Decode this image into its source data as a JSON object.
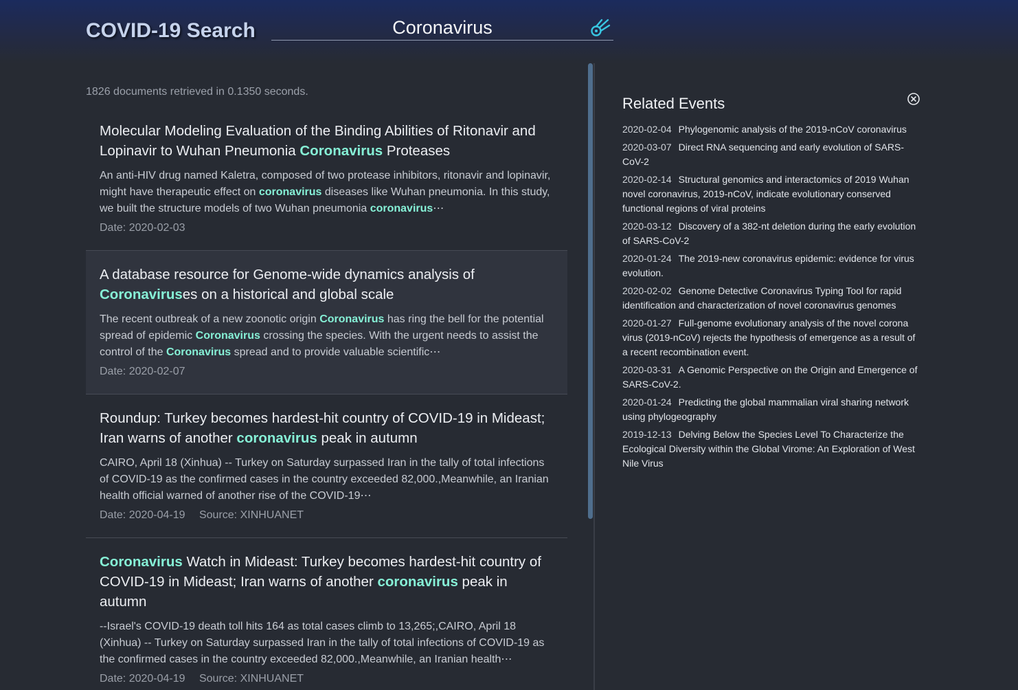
{
  "app": {
    "title": "COVID-19 Search"
  },
  "search": {
    "query": "Coronavirus",
    "submit_icon": "comet-icon"
  },
  "colors": {
    "accent": "#86f0d6",
    "icon": "#38c6e2",
    "header_top": "#1b2b5d",
    "background": "#272b33",
    "card_hover": "#30343e",
    "scrollbar": "#4f6e8d"
  },
  "results": {
    "stats": "1826 documents retrieved in 0.1350 seconds.",
    "items": [
      {
        "title": [
          {
            "text": "Molecular Modeling Evaluation of the Binding Abilities of Ritonavir and Lopinavir to Wuhan Pneumonia ",
            "hl": false
          },
          {
            "text": "Coronavirus",
            "hl": true
          },
          {
            "text": " Proteases",
            "hl": false
          }
        ],
        "snippet": [
          {
            "text": "An anti-HIV drug named Kaletra, composed of two protease inhibitors, ritonavir and lopinavir, might have therapeutic effect on ",
            "hl": false
          },
          {
            "text": "coronavirus",
            "hl": true
          },
          {
            "text": " diseases like Wuhan pneumonia. In this study, we built the structure models of two Wuhan pneumonia ",
            "hl": false
          },
          {
            "text": "coronavirus",
            "hl": true
          },
          {
            "text": "⋯",
            "hl": false
          }
        ],
        "date": "Date: 2020-02-03"
      },
      {
        "title": [
          {
            "text": "A database resource for Genome-wide dynamics analysis of ",
            "hl": false
          },
          {
            "text": "Coronavirus",
            "hl": true
          },
          {
            "text": "es on a historical and global scale",
            "hl": false
          }
        ],
        "snippet": [
          {
            "text": "The recent outbreak of a new zoonotic origin ",
            "hl": false
          },
          {
            "text": "Coronavirus",
            "hl": true
          },
          {
            "text": " has ring the bell for the potential spread of epidemic ",
            "hl": false
          },
          {
            "text": "Coronavirus",
            "hl": true
          },
          {
            "text": " crossing the species. With the urgent needs to assist the control of the ",
            "hl": false
          },
          {
            "text": "Coronavirus",
            "hl": true
          },
          {
            "text": " spread and to provide valuable scientific⋯",
            "hl": false
          }
        ],
        "date": "Date: 2020-02-07"
      },
      {
        "title": [
          {
            "text": "Roundup: Turkey becomes hardest-hit country of COVID-19 in Mideast; Iran warns of another ",
            "hl": false
          },
          {
            "text": "coronavirus",
            "hl": true
          },
          {
            "text": " peak in autumn",
            "hl": false
          }
        ],
        "snippet": [
          {
            "text": "CAIRO, April 18 (Xinhua) -- Turkey on Saturday surpassed Iran in the tally of total infections of COVID-19 as the confirmed cases in the country exceeded 82,000.,Meanwhile, an Iranian health official warned of another rise of the COVID-19⋯",
            "hl": false
          }
        ],
        "date": "Date: 2020-04-19",
        "source": "Source: XINHUANET"
      },
      {
        "title": [
          {
            "text": "Coronavirus",
            "hl": true
          },
          {
            "text": " Watch in Mideast: Turkey becomes hardest-hit country of COVID-19 in Mideast; Iran warns of another ",
            "hl": false
          },
          {
            "text": "coronavirus",
            "hl": true
          },
          {
            "text": " peak in autumn",
            "hl": false
          }
        ],
        "snippet": [
          {
            "text": "--Israel's COVID-19 death toll hits 164 as total cases climb to 13,265;,CAIRO, April 18 (Xinhua) -- Turkey on Saturday surpassed Iran in the tally of total infections of COVID-19 as the confirmed cases in the country exceeded 82,000.,Meanwhile, an Iranian health⋯",
            "hl": false
          }
        ],
        "date": "Date: 2020-04-19",
        "source": "Source: XINHUANET"
      }
    ]
  },
  "related": {
    "heading": "Related Events",
    "close_icon": "close-circle-icon",
    "items": [
      {
        "date": "2020-02-04",
        "title": "Phylogenomic analysis of the 2019-nCoV coronavirus"
      },
      {
        "date": "2020-03-07",
        "title": "Direct RNA sequencing and early evolution of SARS-CoV-2"
      },
      {
        "date": "2020-02-14",
        "title": "Structural genomics and interactomics of 2019 Wuhan novel coronavirus, 2019-nCoV, indicate evolutionary conserved functional regions of viral proteins"
      },
      {
        "date": "2020-03-12",
        "title": "Discovery of a 382-nt deletion during the early evolution of SARS-CoV-2"
      },
      {
        "date": "2020-01-24",
        "title": "The 2019-new coronavirus epidemic: evidence for virus evolution."
      },
      {
        "date": "2020-02-02",
        "title": "Genome Detective Coronavirus Typing Tool for rapid identification and characterization of novel coronavirus genomes"
      },
      {
        "date": "2020-01-27",
        "title": "Full-genome evolutionary analysis of the novel corona virus (2019-nCoV) rejects the hypothesis of emergence as a result of a recent recombination event."
      },
      {
        "date": "2020-03-31",
        "title": "A Genomic Perspective on the Origin and Emergence of SARS-CoV-2."
      },
      {
        "date": "2020-01-24",
        "title": "Predicting the global mammalian viral sharing network using phylogeography"
      },
      {
        "date": "2019-12-13",
        "title": "Delving Below the Species Level To Characterize the Ecological Diversity within the Global Virome: An Exploration of West Nile Virus"
      }
    ]
  }
}
